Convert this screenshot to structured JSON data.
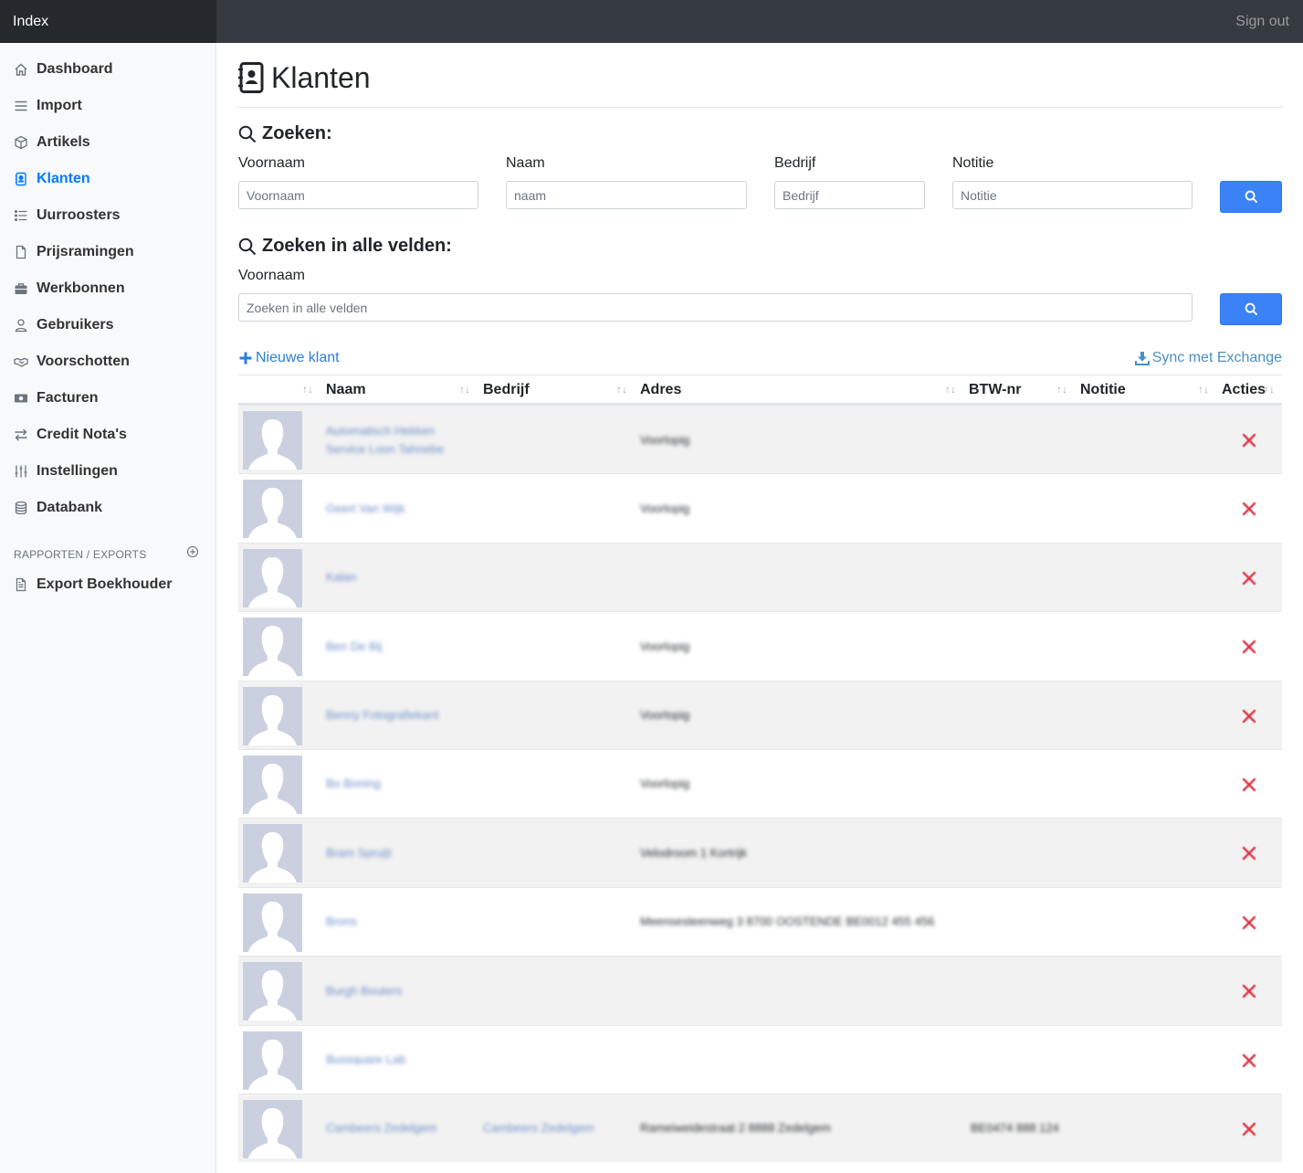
{
  "topbar": {
    "brand": "Index",
    "signout": "Sign out"
  },
  "sidebar": {
    "items": [
      {
        "label": "Dashboard",
        "icon": "home-icon"
      },
      {
        "label": "Import",
        "icon": "menu-icon"
      },
      {
        "label": "Artikels",
        "icon": "box-icon"
      },
      {
        "label": "Klanten",
        "icon": "contact-book-icon",
        "active": true
      },
      {
        "label": "Uurroosters",
        "icon": "list-icon"
      },
      {
        "label": "Prijsramingen",
        "icon": "file-icon"
      },
      {
        "label": "Werkbonnen",
        "icon": "briefcase-icon"
      },
      {
        "label": "Gebruikers",
        "icon": "user-icon"
      },
      {
        "label": "Voorschotten",
        "icon": "handshake-icon"
      },
      {
        "label": "Facturen",
        "icon": "money-icon"
      },
      {
        "label": "Credit Nota's",
        "icon": "exchange-icon"
      },
      {
        "label": "Instellingen",
        "icon": "sliders-icon"
      },
      {
        "label": "Databank",
        "icon": "database-icon"
      }
    ],
    "section_heading": "RAPPORTEN / EXPORTS",
    "report_items": [
      {
        "label": "Export Boekhouder",
        "icon": "file-text-icon"
      }
    ]
  },
  "page": {
    "title": "Klanten"
  },
  "search": {
    "heading": "Zoeken:",
    "fields": {
      "voornaam": {
        "label": "Voornaam",
        "placeholder": "Voornaam"
      },
      "naam": {
        "label": "Naam",
        "placeholder": "naam"
      },
      "bedrijf": {
        "label": "Bedrijf",
        "placeholder": "Bedrijf"
      },
      "notitie": {
        "label": "Notitie",
        "placeholder": "Notitie"
      }
    }
  },
  "search_all": {
    "heading": "Zoeken in alle velden:",
    "label": "Voornaam",
    "placeholder": "Zoeken in alle velden"
  },
  "actions": {
    "new_client": "Nieuwe klant",
    "sync": "Sync met Exchange"
  },
  "table": {
    "columns": {
      "naam": "Naam",
      "bedrijf": "Bedrijf",
      "adres": "Adres",
      "btw": "BTW-nr",
      "notitie": "Notitie",
      "acties": "Acties"
    },
    "rows": [
      {
        "naam": "Automatisch Hekken",
        "naam2": "Service Loon Tahnebe",
        "bedrijf": "",
        "adres": "Voorlopig",
        "btw": ""
      },
      {
        "naam": "Geert Van Wijk",
        "bedrijf": "",
        "adres": "Voorlopig",
        "btw": ""
      },
      {
        "naam": "Kalan",
        "bedrijf": "",
        "adres": "",
        "btw": ""
      },
      {
        "naam": "Ben De Bij",
        "bedrijf": "",
        "adres": "Voorlopig",
        "btw": ""
      },
      {
        "naam": "Benny Fotografiekant",
        "bedrijf": "",
        "adres": "Voorlopig",
        "btw": ""
      },
      {
        "naam": "Bo Boning",
        "bedrijf": "",
        "adres": "Voorlopig",
        "btw": ""
      },
      {
        "naam": "Bram Spruijt",
        "bedrijf": "",
        "adres": "Velodroom 1 Kortrijk",
        "btw": ""
      },
      {
        "naam": "Brons",
        "bedrijf": "",
        "adres": "Meensesteenweg 3 8700 OOSTENDE BE0012 455 456",
        "btw": ""
      },
      {
        "naam": "Burgh Bouters",
        "bedrijf": "",
        "adres": "",
        "btw": ""
      },
      {
        "naam": "Bussquare Lab",
        "bedrijf": "",
        "adres": "",
        "btw": ""
      },
      {
        "naam": "Cambeers Zedelgem",
        "bedrijf": "Cambeers Zedelgem",
        "adres": "Rameiweidestraat 2 8888 Zedelgem",
        "btw": "BE0474 888 124"
      }
    ]
  },
  "colors": {
    "accent": "#007bff",
    "button": "#3b82f6",
    "delete": "#dc3545",
    "topbar": "#343a40",
    "sidebar": "#f8f9fa"
  }
}
